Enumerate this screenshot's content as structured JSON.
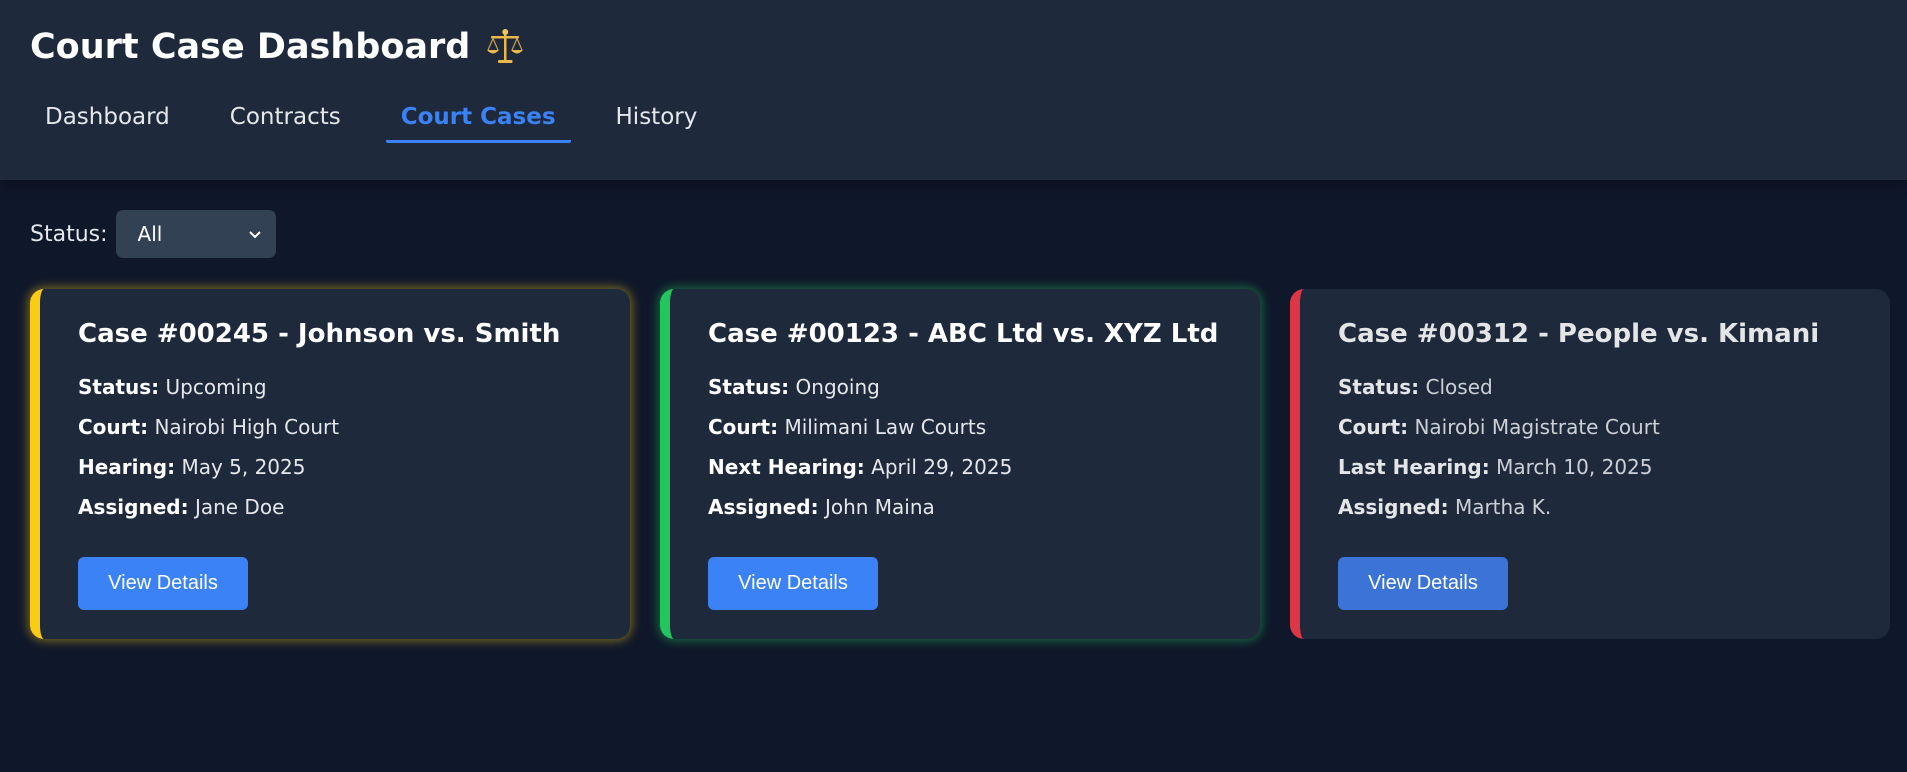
{
  "app": {
    "title": "Court Case Dashboard"
  },
  "nav": {
    "tabs": [
      {
        "label": "Dashboard"
      },
      {
        "label": "Contracts"
      },
      {
        "label": "Court Cases"
      },
      {
        "label": "History"
      }
    ],
    "active": "Court Cases"
  },
  "filter": {
    "label": "Status:",
    "selected": "All"
  },
  "cases": [
    {
      "title": "Case #00245 - Johnson vs. Smith",
      "status_label": "Status:",
      "status": "Upcoming",
      "court_label": "Court:",
      "court": "Nairobi High Court",
      "hearing_label": "Hearing:",
      "hearing": "May 5, 2025",
      "assigned_label": "Assigned:",
      "assigned": "Jane Doe",
      "button": "View Details",
      "accent": "#facc15"
    },
    {
      "title": "Case #00123 - ABC Ltd vs. XYZ Ltd",
      "status_label": "Status:",
      "status": "Ongoing",
      "court_label": "Court:",
      "court": "Milimani Law Courts",
      "hearing_label": "Next Hearing:",
      "hearing": "April 29, 2025",
      "assigned_label": "Assigned:",
      "assigned": "John Maina",
      "button": "View Details",
      "accent": "#22c55e"
    },
    {
      "title": "Case #00312 - People vs. Kimani",
      "status_label": "Status:",
      "status": "Closed",
      "court_label": "Court:",
      "court": "Nairobi Magistrate Court",
      "hearing_label": "Last Hearing:",
      "hearing": "March 10, 2025",
      "assigned_label": "Assigned:",
      "assigned": "Martha K.",
      "button": "View Details",
      "accent": "#dc3545"
    }
  ],
  "colors": {
    "background": "#0f172a",
    "header": "#1e293b",
    "card": "#1e293b",
    "primary": "#3b82f6"
  },
  "icons": {
    "title_icon": "scales-of-justice-icon",
    "select_icon": "chevron-down-icon"
  }
}
